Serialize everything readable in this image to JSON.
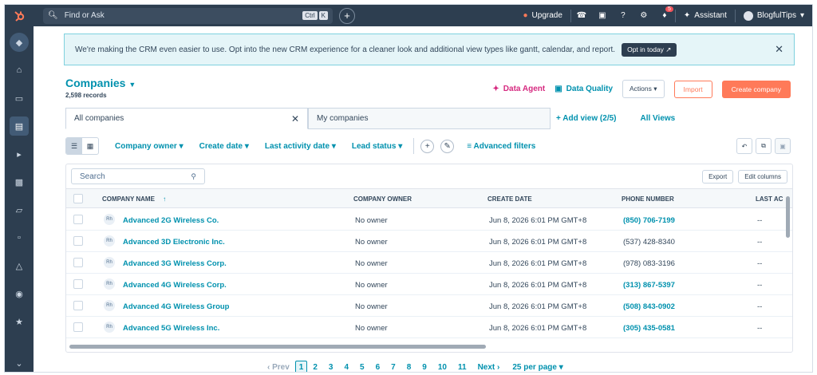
{
  "topbar": {
    "search_placeholder": "Find or Ask",
    "kbd_ctrl": "Ctrl",
    "kbd_k": "K",
    "upgrade": "Upgrade",
    "notification_count": "5",
    "assistant": "Assistant",
    "account": "BlogfulTips"
  },
  "banner": {
    "text": "We're making the CRM even easier to use. Opt into the new CRM experience for a cleaner look and additional view types like gantt, calendar, and report.",
    "button": "Opt in today"
  },
  "page": {
    "title": "Companies",
    "records": "2,598 records",
    "data_agent": "Data Agent",
    "data_quality": "Data Quality",
    "actions": "Actions",
    "import": "Import",
    "create": "Create company"
  },
  "tabs": {
    "all": "All companies",
    "mine": "My companies",
    "add_view": "Add view (2/5)",
    "all_views": "All Views"
  },
  "filters": {
    "owner": "Company owner",
    "create_date": "Create date",
    "last_activity": "Last activity date",
    "lead_status": "Lead status",
    "advanced": "Advanced filters"
  },
  "table": {
    "search_placeholder": "Search",
    "export": "Export",
    "edit_columns": "Edit columns",
    "columns": [
      "COMPANY NAME",
      "COMPANY OWNER",
      "CREATE DATE",
      "PHONE NUMBER",
      "LAST AC"
    ],
    "rows": [
      {
        "name": "Advanced 2G Wireless Co.",
        "owner": "No owner",
        "date": "Jun 8, 2026 6:01 PM GMT+8",
        "phone": "(850) 706-7199",
        "last": "--"
      },
      {
        "name": "Advanced 3D Electronic Inc.",
        "owner": "No owner",
        "date": "Jun 8, 2026 6:01 PM GMT+8",
        "phone": "(537) 428-8340",
        "last": "--"
      },
      {
        "name": "Advanced 3G Wireless Corp.",
        "owner": "No owner",
        "date": "Jun 8, 2026 6:01 PM GMT+8",
        "phone": "(978) 083-3196",
        "last": "--"
      },
      {
        "name": "Advanced 4G Wireless Corp.",
        "owner": "No owner",
        "date": "Jun 8, 2026 6:01 PM GMT+8",
        "phone": "(313) 867-5397",
        "last": "--"
      },
      {
        "name": "Advanced 4G Wireless Group",
        "owner": "No owner",
        "date": "Jun 8, 2026 6:01 PM GMT+8",
        "phone": "(508) 843-0902",
        "last": "--"
      },
      {
        "name": "Advanced 5G Wireless Inc.",
        "owner": "No owner",
        "date": "Jun 8, 2026 6:01 PM GMT+8",
        "phone": "(305) 435-0581",
        "last": "--"
      }
    ]
  },
  "pager": {
    "prev": "Prev",
    "pages": [
      "1",
      "2",
      "3",
      "4",
      "5",
      "6",
      "7",
      "8",
      "9",
      "10",
      "11"
    ],
    "next": "Next",
    "per_page": "25 per page"
  },
  "colors": {
    "nav": "#2d3e50",
    "link": "#0091ae",
    "accent": "#ff7a59",
    "agent": "#d62a80"
  }
}
